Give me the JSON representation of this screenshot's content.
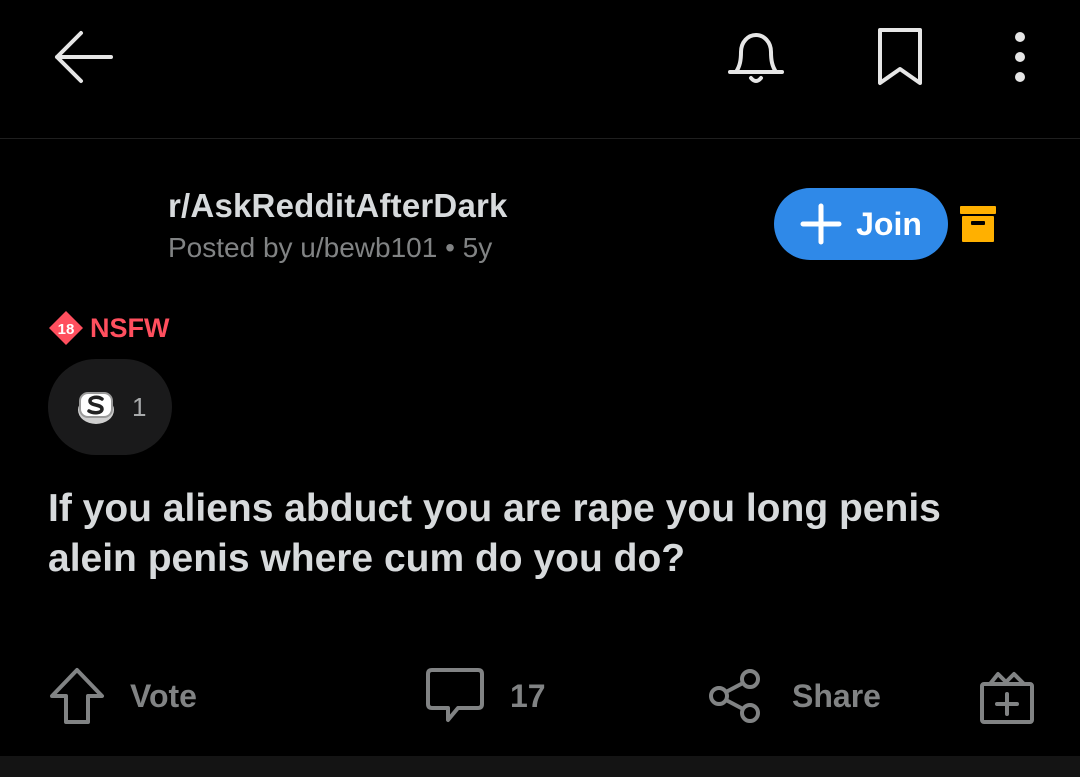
{
  "header": {
    "back_icon": "arrow-left-icon",
    "bell_icon": "bell-icon",
    "bookmark_icon": "bookmark-icon",
    "more_icon": "more-vertical-icon"
  },
  "post": {
    "subreddit": "r/AskRedditAfterDark",
    "meta": "Posted by u/bewb101 • 5y",
    "join_label": "Join",
    "nsfw_badge": "18",
    "nsfw_label": "NSFW",
    "award_count": "1",
    "title": "If you aliens abduct you are rape you long penis alein penis where cum do you do?"
  },
  "actions": {
    "vote_label": "Vote",
    "comment_count": "17",
    "share_label": "Share"
  },
  "colors": {
    "background": "#000000",
    "accent": "#2f89e8",
    "nsfw": "#ff4f5e",
    "archive": "#ffb000",
    "muted": "#818384"
  }
}
